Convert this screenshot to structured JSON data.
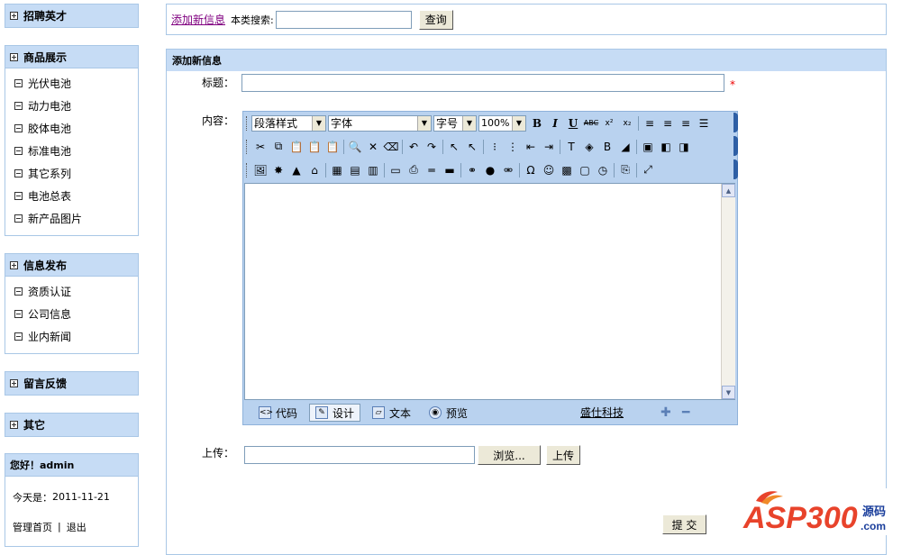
{
  "sidebar": {
    "sections": [
      {
        "id": "recruit",
        "title": "招聘英才",
        "icon": "plus",
        "items": []
      },
      {
        "id": "products",
        "title": "商品展示",
        "icon": "minus",
        "items": [
          "光伏电池",
          "动力电池",
          "胶体电池",
          "标准电池",
          "其它系列",
          "电池总表",
          "新产品图片"
        ]
      },
      {
        "id": "info",
        "title": "信息发布",
        "icon": "minus",
        "items": [
          "资质认证",
          "公司信息",
          "业内新闻"
        ]
      },
      {
        "id": "feedback",
        "title": "留言反馈",
        "icon": "plus",
        "items": []
      },
      {
        "id": "other",
        "title": "其它",
        "icon": "plus",
        "items": []
      }
    ],
    "user": {
      "greeting": "您好！admin",
      "today_label": "今天是：",
      "today_value": "2011-11-21",
      "home_link": "管理首页",
      "divider": "|",
      "logout_link": "退出"
    }
  },
  "topbar": {
    "add_link": "添加新信息",
    "search_label": "本类搜索:",
    "search_value": "",
    "search_button": "查询"
  },
  "form": {
    "header": "添加新信息",
    "title_label": "标题：",
    "title_value": "",
    "required_mark": "*",
    "content_label": "内容：",
    "upload_label": "上传：",
    "browse_button": "浏览...",
    "upload_button": "上传",
    "submit_button": "提 交"
  },
  "editor": {
    "paragraph_style": "段落样式",
    "font_family": "字体",
    "font_size": "字号",
    "zoom": "100%",
    "modes": [
      {
        "id": "code",
        "label": "代码",
        "icon": "code-mode-icon"
      },
      {
        "id": "design",
        "label": "设计",
        "icon": "design-mode-icon"
      },
      {
        "id": "text",
        "label": "文本",
        "icon": "text-mode-icon"
      },
      {
        "id": "preview",
        "label": "预览",
        "icon": "preview-globe-icon"
      }
    ],
    "active_mode": "design",
    "brand_link": "盛仕科技",
    "content": ""
  },
  "watermark": {
    "logo_text": "ASP300",
    "logo_suffix": "源码",
    "logo_domain": ".com"
  },
  "colors": {
    "panel_header": "#c6dcf5",
    "panel_border": "#a9c7e6",
    "editor_toolbar": "#b9d2ef",
    "link_visited": "#800080",
    "required": "#e00000",
    "logo_red": "#e8432b",
    "logo_blue": "#1b3f9c"
  }
}
